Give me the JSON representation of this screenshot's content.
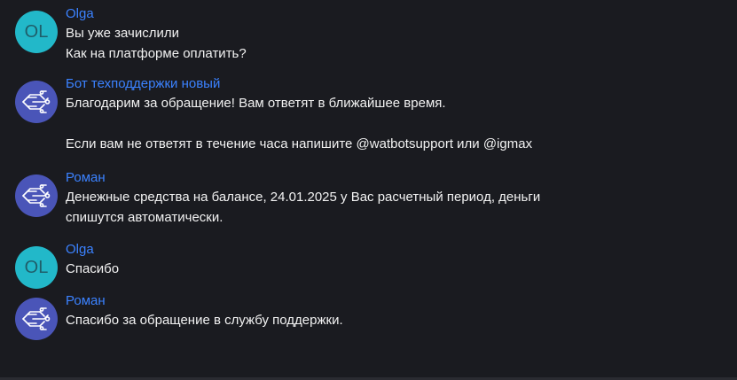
{
  "messages": [
    {
      "author": "Olga",
      "avatar_text": "OL",
      "avatar_icon": "initials-avatar",
      "lines": [
        "Вы уже зачислили",
        "Как на платформе оплатить?"
      ]
    },
    {
      "author": "Бот техподдержки новый",
      "avatar_icon": "circuit-bot-icon",
      "lines": [
        "Благодарим за обращение! Вам ответят в ближайшее время.",
        "Если вам не ответят в течение часа напишите @watbotsupport или @igmax"
      ]
    },
    {
      "author": "Роман",
      "avatar_icon": "circuit-bot-icon",
      "lines": [
        "Денежные средства на балансе, 24.01.2025 у Вас расчетный период, деньги",
        "спишутся автоматически."
      ]
    },
    {
      "author": "Olga",
      "avatar_text": "OL",
      "avatar_icon": "initials-avatar",
      "lines": [
        "Спасибо"
      ]
    },
    {
      "author": "Роман",
      "avatar_icon": "circuit-bot-icon",
      "lines": [
        "Спасибо за обращение в службу поддержки."
      ]
    }
  ],
  "colors": {
    "background": "#1a1b20",
    "author_name": "#3b82ff",
    "message_text": "#f2f2f2",
    "initials_avatar_bg": "#22b8c9",
    "bot_avatar_bg": "#4a55b8"
  }
}
